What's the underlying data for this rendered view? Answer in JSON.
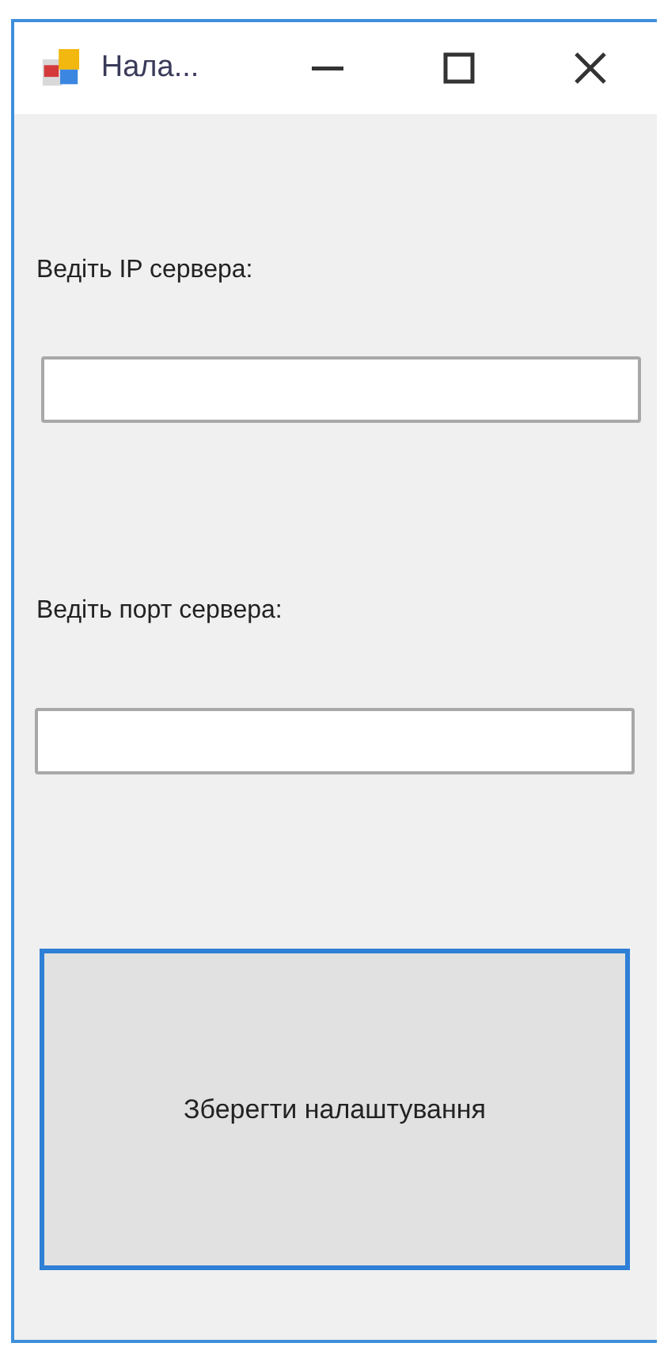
{
  "window": {
    "title": "Нала..."
  },
  "fields": [
    {
      "label": "Ведіть IP сервера:"
    },
    {
      "label": "Ведіть порт сервера:"
    }
  ],
  "button": {
    "label": "Зберегти налаштування",
    "focused": true
  }
}
